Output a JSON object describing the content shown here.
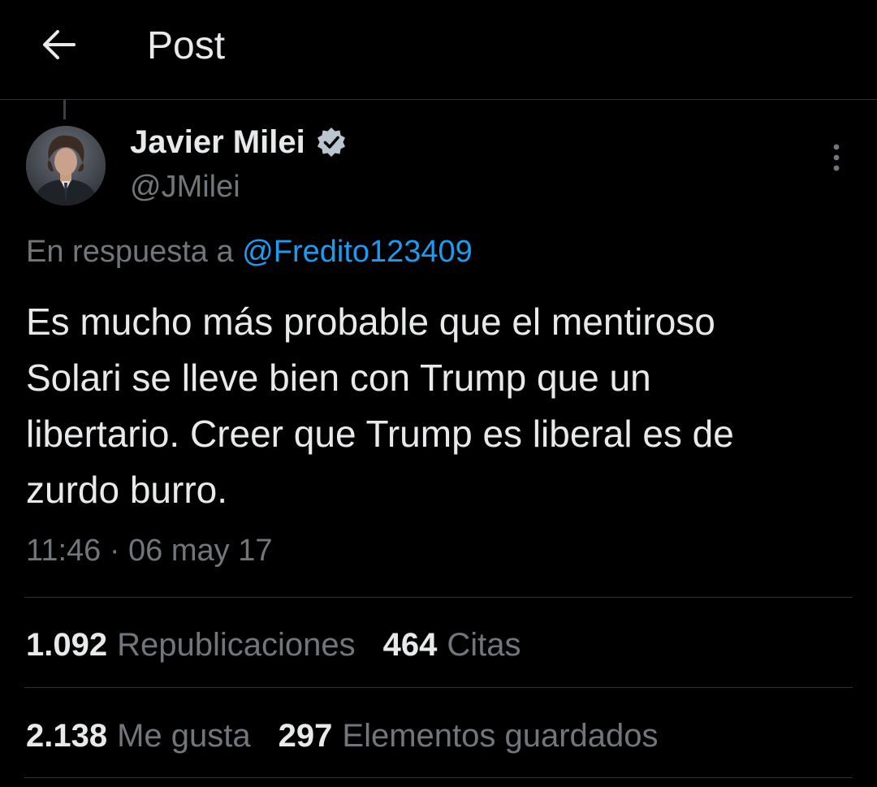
{
  "header": {
    "title": "Post",
    "back_icon": "arrow-left-icon"
  },
  "author": {
    "name": "Javier Milei",
    "handle": "@JMilei",
    "verified": true,
    "verified_color": "#b9c5d1",
    "avatar_icon": "profile-photo"
  },
  "reply": {
    "prefix": "En respuesta a ",
    "mention": "@Fredito123409"
  },
  "post": {
    "text": "Es mucho más probable que el mentiroso\nSolari se lleve bien con Trump que un\nlibertario. Creer que Trump es liberal es de\nzurdo burro.",
    "timestamp": "11:46 · 06 may 17"
  },
  "stats": {
    "reposts_count": "1.092",
    "reposts_label": "Republicaciones",
    "quotes_count": "464",
    "quotes_label": "Citas",
    "likes_count": "2.138",
    "likes_label": "Me gusta",
    "bookmarks_count": "297",
    "bookmarks_label": "Elementos guardados"
  },
  "colors": {
    "background": "#000000",
    "text": "#e7e9ea",
    "muted": "#71767b",
    "link": "#1d9bf0",
    "divider": "#2f3336"
  }
}
